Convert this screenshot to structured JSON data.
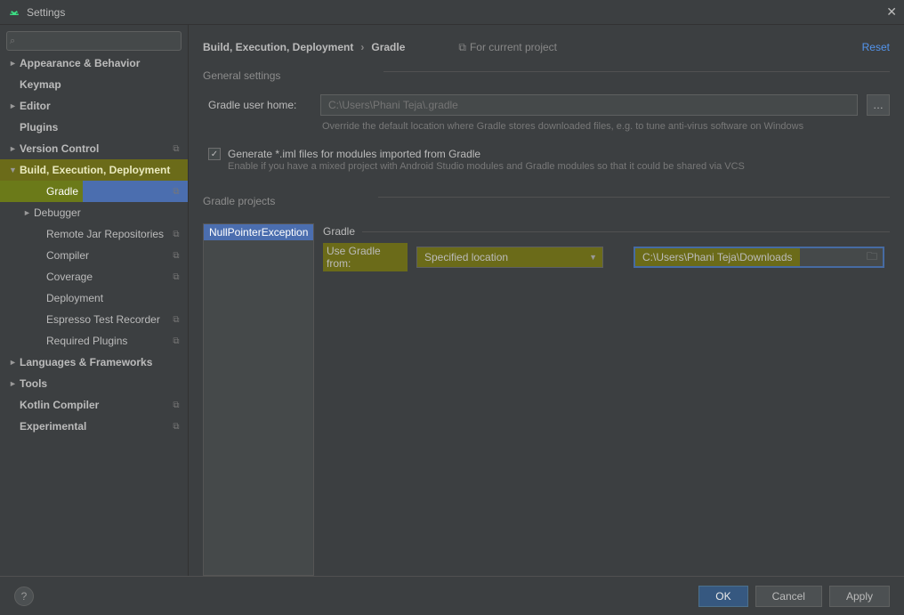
{
  "window": {
    "title": "Settings"
  },
  "search": {
    "placeholder": ""
  },
  "sidebar": {
    "items": [
      {
        "label": "Appearance & Behavior",
        "arrow": "►",
        "bold": true
      },
      {
        "label": "Keymap",
        "bold": true
      },
      {
        "label": "Editor",
        "arrow": "►",
        "bold": true
      },
      {
        "label": "Plugins",
        "bold": true
      },
      {
        "label": "Version Control",
        "arrow": "►",
        "bold": true,
        "badge": true
      },
      {
        "label": "Build, Execution, Deployment",
        "arrow": "▼",
        "bold": true,
        "style": "hl-yellow"
      },
      {
        "label": "Gradle",
        "style": "selected sel-green",
        "badge": true,
        "lvl": 3
      },
      {
        "label": "Debugger",
        "arrow": "►",
        "lvl": 2
      },
      {
        "label": "Remote Jar Repositories",
        "badge": true,
        "lvl": 3
      },
      {
        "label": "Compiler",
        "badge": true,
        "lvl": 3
      },
      {
        "label": "Coverage",
        "badge": true,
        "lvl": 3
      },
      {
        "label": "Deployment",
        "lvl": 3
      },
      {
        "label": "Espresso Test Recorder",
        "badge": true,
        "lvl": 3
      },
      {
        "label": "Required Plugins",
        "badge": true,
        "lvl": 3
      },
      {
        "label": "Languages & Frameworks",
        "arrow": "►",
        "bold": true
      },
      {
        "label": "Tools",
        "arrow": "►",
        "bold": true
      },
      {
        "label": "Kotlin Compiler",
        "bold": true,
        "badge": true
      },
      {
        "label": "Experimental",
        "bold": true,
        "badge": true
      }
    ]
  },
  "breadcrumb": {
    "root": "Build, Execution, Deployment",
    "leaf": "Gradle"
  },
  "topbar": {
    "for_project": "For current project",
    "reset": "Reset"
  },
  "general": {
    "section": "General settings",
    "user_home_label": "Gradle user home:",
    "user_home_placeholder": "C:\\Users\\Phani Teja\\.gradle",
    "user_home_hint": "Override the default location where Gradle stores downloaded files, e.g. to tune anti-virus software on Windows",
    "gen_iml_label": "Generate *.iml files for modules imported from Gradle",
    "gen_iml_hint": "Enable if you have a mixed project with Android Studio modules and Gradle modules so that it could be shared via VCS"
  },
  "projects": {
    "section": "Gradle projects",
    "list": [
      "NullPointerException"
    ],
    "group": "Gradle",
    "use_from_label": "Use Gradle from:",
    "use_from_value": "Specified location",
    "path_value": "C:\\Users\\Phani Teja\\Downloads"
  },
  "buttons": {
    "ok": "OK",
    "cancel": "Cancel",
    "apply": "Apply"
  }
}
